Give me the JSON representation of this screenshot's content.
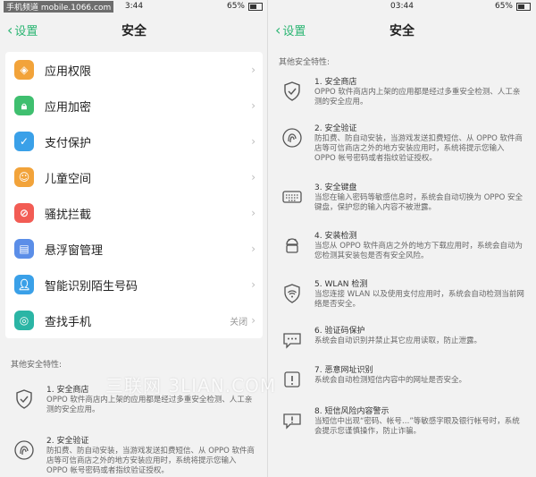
{
  "left": {
    "status": {
      "time": "3:44",
      "battery": "65%",
      "watermark": "手机频道 mobile.1066.com"
    },
    "back_label": "设置",
    "title": "安全",
    "items": [
      {
        "label": "应用权限",
        "value": "",
        "color": "#f2a33a",
        "icon": "shield-icon"
      },
      {
        "label": "应用加密",
        "value": "",
        "color": "#3fbf6f",
        "icon": "lock-icon"
      },
      {
        "label": "支付保护",
        "value": "",
        "color": "#3aa0e8",
        "icon": "shield-check-icon"
      },
      {
        "label": "儿童空间",
        "value": "",
        "color": "#f2a33a",
        "icon": "child-icon"
      },
      {
        "label": "骚扰拦截",
        "value": "",
        "color": "#f25c54",
        "icon": "block-icon"
      },
      {
        "label": "悬浮窗管理",
        "value": "",
        "color": "#5b8ee8",
        "icon": "window-icon"
      },
      {
        "label": "智能识别陌生号码",
        "value": "",
        "color": "#3aa0e8",
        "icon": "contact-icon"
      },
      {
        "label": "查找手机",
        "value": "关闭",
        "color": "#2bb5a5",
        "icon": "locate-icon"
      }
    ],
    "section_header": "其他安全特性:",
    "features": [
      {
        "title": "1. 安全商店",
        "desc": "OPPO 软件商店内上架的应用都是经过多重安全检测、人工亲测的安全应用。",
        "icon": "shield-check-icon"
      },
      {
        "title": "2. 安全验证",
        "desc": "防扣费、防自动安装，当游戏发送扣费短信、从 OPPO 软件商店等可信商店之外的地方安装应用时，系统将提示您输入 OPPO 帐号密码或者指纹验证授权。",
        "icon": "fingerprint-icon"
      }
    ]
  },
  "right": {
    "status": {
      "time": "03:44",
      "battery": "65%"
    },
    "back_label": "设置",
    "title": "安全",
    "section_header": "其他安全特性:",
    "features": [
      {
        "title": "1. 安全商店",
        "desc": "OPPO 软件商店内上架的应用都是经过多重安全检测、人工亲测的安全应用。",
        "icon": "shield-check-icon"
      },
      {
        "title": "2. 安全验证",
        "desc": "防扣费、防自动安装，当游戏发送扣费短信、从 OPPO 软件商店等可信商店之外的地方安装应用时，系统将提示您输入 OPPO 帐号密码或者指纹验证授权。",
        "icon": "fingerprint-icon"
      },
      {
        "title": "3. 安全键盘",
        "desc": "当您在输入密码等敏感信息时，系统会自动切换为 OPPO 安全键盘，保护您的输入内容不被泄露。",
        "icon": "keyboard-icon"
      },
      {
        "title": "4. 安装检测",
        "desc": "当您从 OPPO 软件商店之外的地方下载应用时，系统会自动为您检测其安装包是否有安全风险。",
        "icon": "android-icon"
      },
      {
        "title": "5. WLAN 检测",
        "desc": "当您连接 WLAN 以及使用支付应用时，系统会自动检测当前网络是否安全。",
        "icon": "wifi-shield-icon"
      },
      {
        "title": "6. 验证码保护",
        "desc": "系统会自动识别并禁止其它应用读取，防止泄露。",
        "icon": "message-lock-icon"
      },
      {
        "title": "7. 恶意网址识别",
        "desc": "系统会自动检测短信内容中的网址是否安全。",
        "icon": "alert-icon"
      },
      {
        "title": "8. 短信风险内容警示",
        "desc": "当短信中出现“密码、帐号…”等敏感字眼及银行帐号时，系统会提示您谨慎操作，防止诈骗。",
        "icon": "message-alert-icon"
      }
    ]
  },
  "site_watermark": "三联网 3LIAN.COM"
}
